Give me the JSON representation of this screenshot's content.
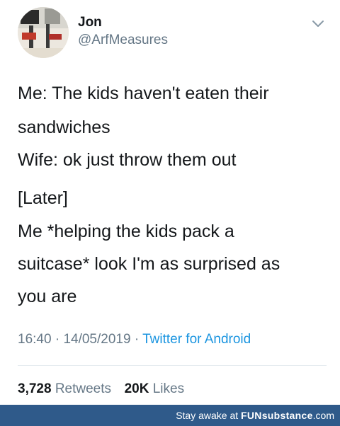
{
  "tweet": {
    "display_name": "Jon",
    "handle": "@ArfMeasures",
    "lines": [
      "Me: The kids haven't eaten their",
      "sandwiches",
      "Wife: ok just throw them out",
      "[Later]",
      "Me *helping the kids pack a",
      "suitcase* look I'm as surprised as",
      "you are"
    ],
    "time": "16:40",
    "date": "14/05/2019",
    "source": "Twitter for Android",
    "retweets_count": "3,728",
    "retweets_label": "Retweets",
    "likes_count": "20K",
    "likes_label": "Likes"
  },
  "footer": {
    "text": "Stay awake at",
    "brand": "FUNsubstance",
    "domain": ".com"
  },
  "colors": {
    "text": "#14171a",
    "muted": "#657786",
    "link": "#1b95e0",
    "footer_bg": "#2f5a8a"
  }
}
